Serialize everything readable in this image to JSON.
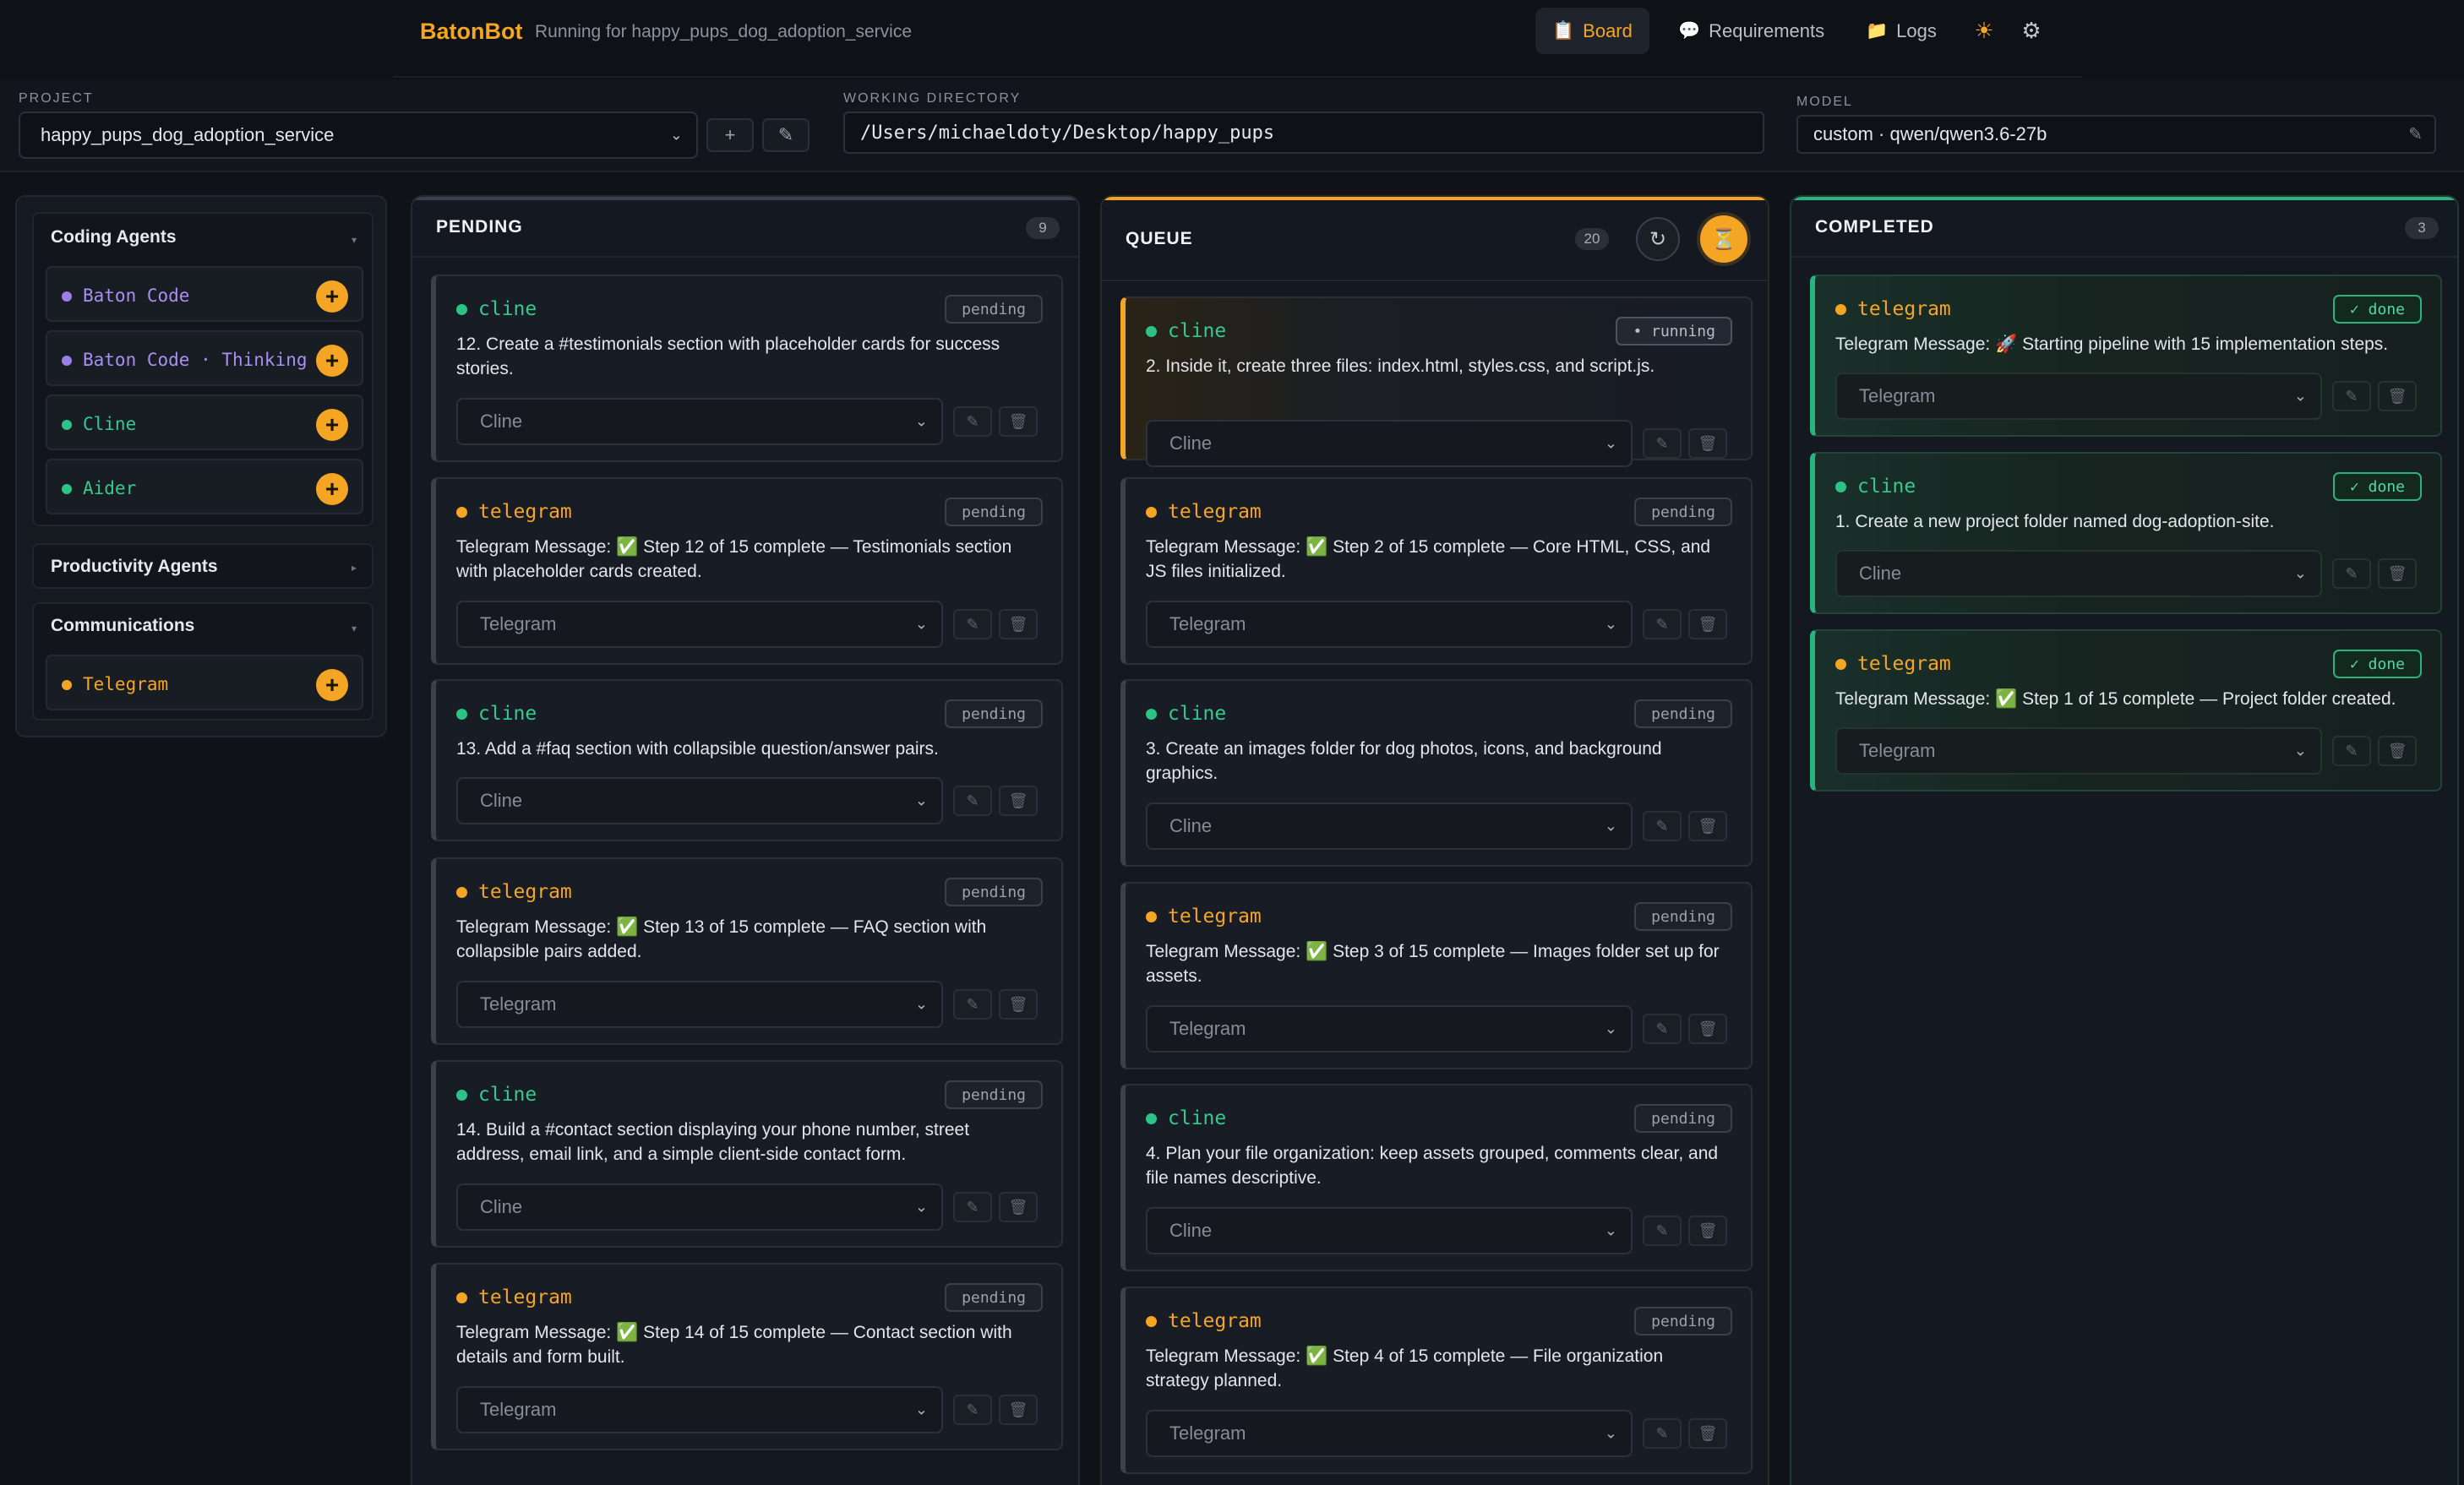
{
  "header": {
    "brand": "BatonBot",
    "subtitle": "Running for happy_pups_dog_adoption_service",
    "nav": [
      {
        "icon": "clipboard-icon",
        "label": "Board",
        "active": true
      },
      {
        "icon": "speech-bubble-icon",
        "label": "Requirements",
        "active": false
      },
      {
        "icon": "folder-icon",
        "label": "Logs",
        "active": false
      }
    ]
  },
  "config": {
    "project_label": "PROJECT",
    "project_value": "happy_pups_dog_adoption_service",
    "workdir_label": "WORKING DIRECTORY",
    "workdir_value": "/Users/michaeldoty/Desktop/happy_pups",
    "model_label": "MODEL",
    "model_value": "custom · qwen/qwen3.6-27b"
  },
  "sidebar": {
    "groups": [
      {
        "title": "Coding Agents",
        "agents": [
          {
            "name": "Baton Code",
            "color": "#9b7fe8"
          },
          {
            "name": "Baton Code · Thinking",
            "color": "#9b7fe8"
          },
          {
            "name": "Cline",
            "color": "#2bc486"
          },
          {
            "name": "Aider",
            "color": "#2bc486"
          }
        ]
      },
      {
        "title": "Productivity Agents",
        "agents": []
      },
      {
        "title": "Communications",
        "agents": [
          {
            "name": "Telegram",
            "color": "#f5a524"
          }
        ]
      }
    ]
  },
  "columns": {
    "pending": {
      "title": "PENDING",
      "count": "9",
      "cards": [
        {
          "agent": "cline",
          "status": "pending",
          "text": "12. Create a #testimonials section with placeholder cards for success stories.",
          "select": "Cline"
        },
        {
          "agent": "telegram",
          "status": "pending",
          "text": "Telegram Message: ✅ Step 12 of 15 complete — Testimonials section with placeholder cards created.",
          "select": "Telegram"
        },
        {
          "agent": "cline",
          "status": "pending",
          "text": "13. Add a #faq section with collapsible question/answer pairs.",
          "select": "Cline"
        },
        {
          "agent": "telegram",
          "status": "pending",
          "text": "Telegram Message: ✅ Step 13 of 15 complete — FAQ section with collapsible pairs added.",
          "select": "Telegram"
        },
        {
          "agent": "cline",
          "status": "pending",
          "text": "14. Build a #contact section displaying your phone number, street address, email link, and a simple client-side contact form.",
          "select": "Cline"
        },
        {
          "agent": "telegram",
          "status": "pending",
          "text": "Telegram Message: ✅ Step 14 of 15 complete — Contact section with details and form built.",
          "select": "Telegram"
        }
      ]
    },
    "queue": {
      "title": "QUEUE",
      "count": "20",
      "cards": [
        {
          "agent": "cline",
          "status": "• running",
          "text": "2. Inside it, create three files: index.html, styles.css, and script.js.",
          "select": "Cline"
        },
        {
          "agent": "telegram",
          "status": "pending",
          "text": "Telegram Message: ✅ Step 2 of 15 complete — Core HTML, CSS, and JS files initialized.",
          "select": "Telegram"
        },
        {
          "agent": "cline",
          "status": "pending",
          "text": "3. Create an images folder for dog photos, icons, and background graphics.",
          "select": "Cline"
        },
        {
          "agent": "telegram",
          "status": "pending",
          "text": "Telegram Message: ✅ Step 3 of 15 complete — Images folder set up for assets.",
          "select": "Telegram"
        },
        {
          "agent": "cline",
          "status": "pending",
          "text": "4. Plan your file organization: keep assets grouped, comments clear, and file names descriptive.",
          "select": "Cline"
        },
        {
          "agent": "telegram",
          "status": "pending",
          "text": "Telegram Message: ✅ Step 4 of 15 complete — File organization strategy planned.",
          "select": "Telegram"
        }
      ]
    },
    "completed": {
      "title": "COMPLETED",
      "count": "3",
      "cards": [
        {
          "agent": "telegram",
          "status": "✓ done",
          "text": "Telegram Message: 🚀 Starting pipeline with 15 implementation steps.",
          "select": "Telegram"
        },
        {
          "agent": "cline",
          "status": "✓ done",
          "text": "1. Create a new project folder named dog-adoption-site.",
          "select": "Cline"
        },
        {
          "agent": "telegram",
          "status": "✓ done",
          "text": "Telegram Message: ✅ Step 1 of 15 complete — Project folder created.",
          "select": "Telegram"
        }
      ]
    }
  },
  "colors": {
    "accent": "#f5a524",
    "cline": "#2bc486",
    "baton": "#9b7fe8",
    "done": "#2bb37d"
  }
}
